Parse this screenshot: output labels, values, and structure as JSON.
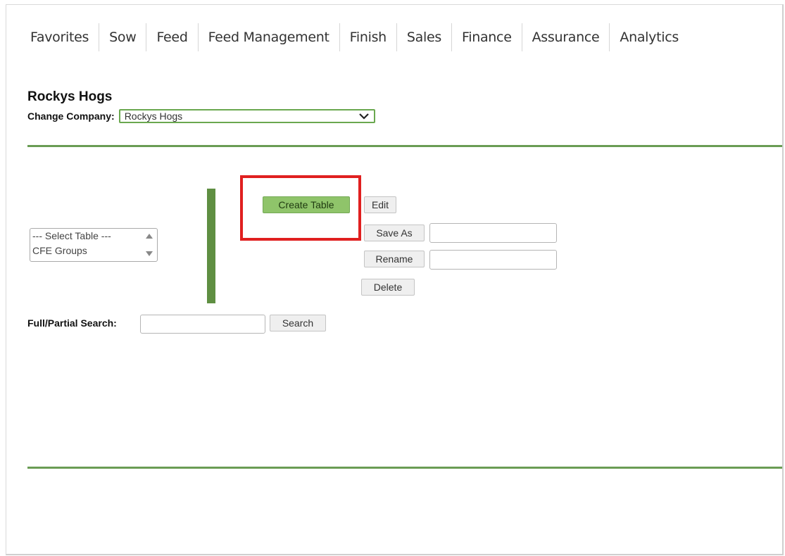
{
  "nav": {
    "tabs": [
      {
        "label": "Favorites"
      },
      {
        "label": "Sow"
      },
      {
        "label": "Feed"
      },
      {
        "label": "Feed Management"
      },
      {
        "label": "Finish"
      },
      {
        "label": "Sales"
      },
      {
        "label": "Finance"
      },
      {
        "label": "Assurance"
      },
      {
        "label": "Analytics"
      }
    ]
  },
  "company": {
    "title": "Rockys Hogs",
    "change_label": "Change Company:",
    "selected": "Rockys Hogs"
  },
  "table_select": {
    "options": [
      "--- Select Table ---",
      "CFE Groups"
    ]
  },
  "actions": {
    "create_label": "Create Table",
    "edit_label": "Edit",
    "save_as_label": "Save As",
    "rename_label": "Rename",
    "delete_label": "Delete"
  },
  "search": {
    "label": "Full/Partial Search:",
    "button_label": "Search",
    "value": ""
  },
  "colors": {
    "accent_green": "#6a9c54",
    "create_button": "#8fc46a",
    "highlight": "#e02020"
  }
}
